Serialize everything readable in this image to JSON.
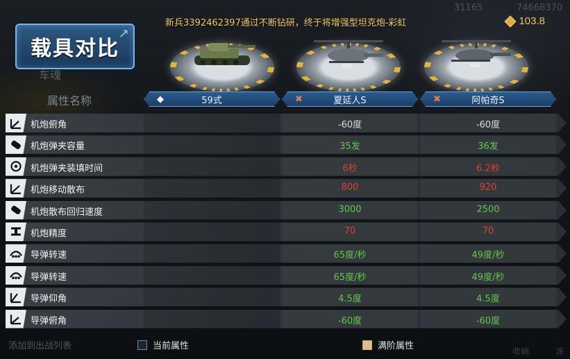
{
  "title": "载具对比",
  "ghost_heading": "车魂",
  "topbar": {
    "res1": "31165",
    "res2": "74668370",
    "currency": "103.8"
  },
  "broadcast": {
    "player": "新兵3392462397",
    "text": "通过不断钻研，终于将",
    "item": "增强型坦克炮-彩虹"
  },
  "columns": {
    "attr_label": "属性名称",
    "vehicles": [
      "59式",
      "夏延人S",
      "阿帕奇S"
    ]
  },
  "rows": [
    {
      "name": "机炮俯角",
      "v2": "-60度",
      "v3": "-60度"
    },
    {
      "name": "机炮弹夹容量",
      "v2": "35发",
      "v3": "36发"
    },
    {
      "name": "机炮弹夹装填时间",
      "v2": "6秒",
      "v3": "6.2秒"
    },
    {
      "name": "机炮移动散布",
      "v2": "800",
      "v3": "920"
    },
    {
      "name": "机炮散布回归速度",
      "v2": "3000",
      "v3": "2500"
    },
    {
      "name": "机炮精度",
      "v2": "70",
      "v3": "70"
    },
    {
      "name": "导弹转速",
      "v2": "65度/秒",
      "v3": "49度/秒"
    },
    {
      "name": "导弹转速",
      "v2": "65度/秒",
      "v3": "49度/秒"
    },
    {
      "name": "导弹仰角",
      "v2": "4.5度",
      "v3": "4.5度"
    },
    {
      "name": "导弹俯角",
      "v2": "-60度",
      "v3": "-60度"
    }
  ],
  "footer": {
    "add_label": "添加到出战列表",
    "legend_current": "当前属性",
    "legend_max": "满阶属性",
    "corner_1": "收纳",
    "corner_2": "涂"
  },
  "colors": {
    "better": "#62c948",
    "worse": "#e0412e",
    "accent_blue": "#2a5b8e",
    "gold": "#f0c35a"
  }
}
